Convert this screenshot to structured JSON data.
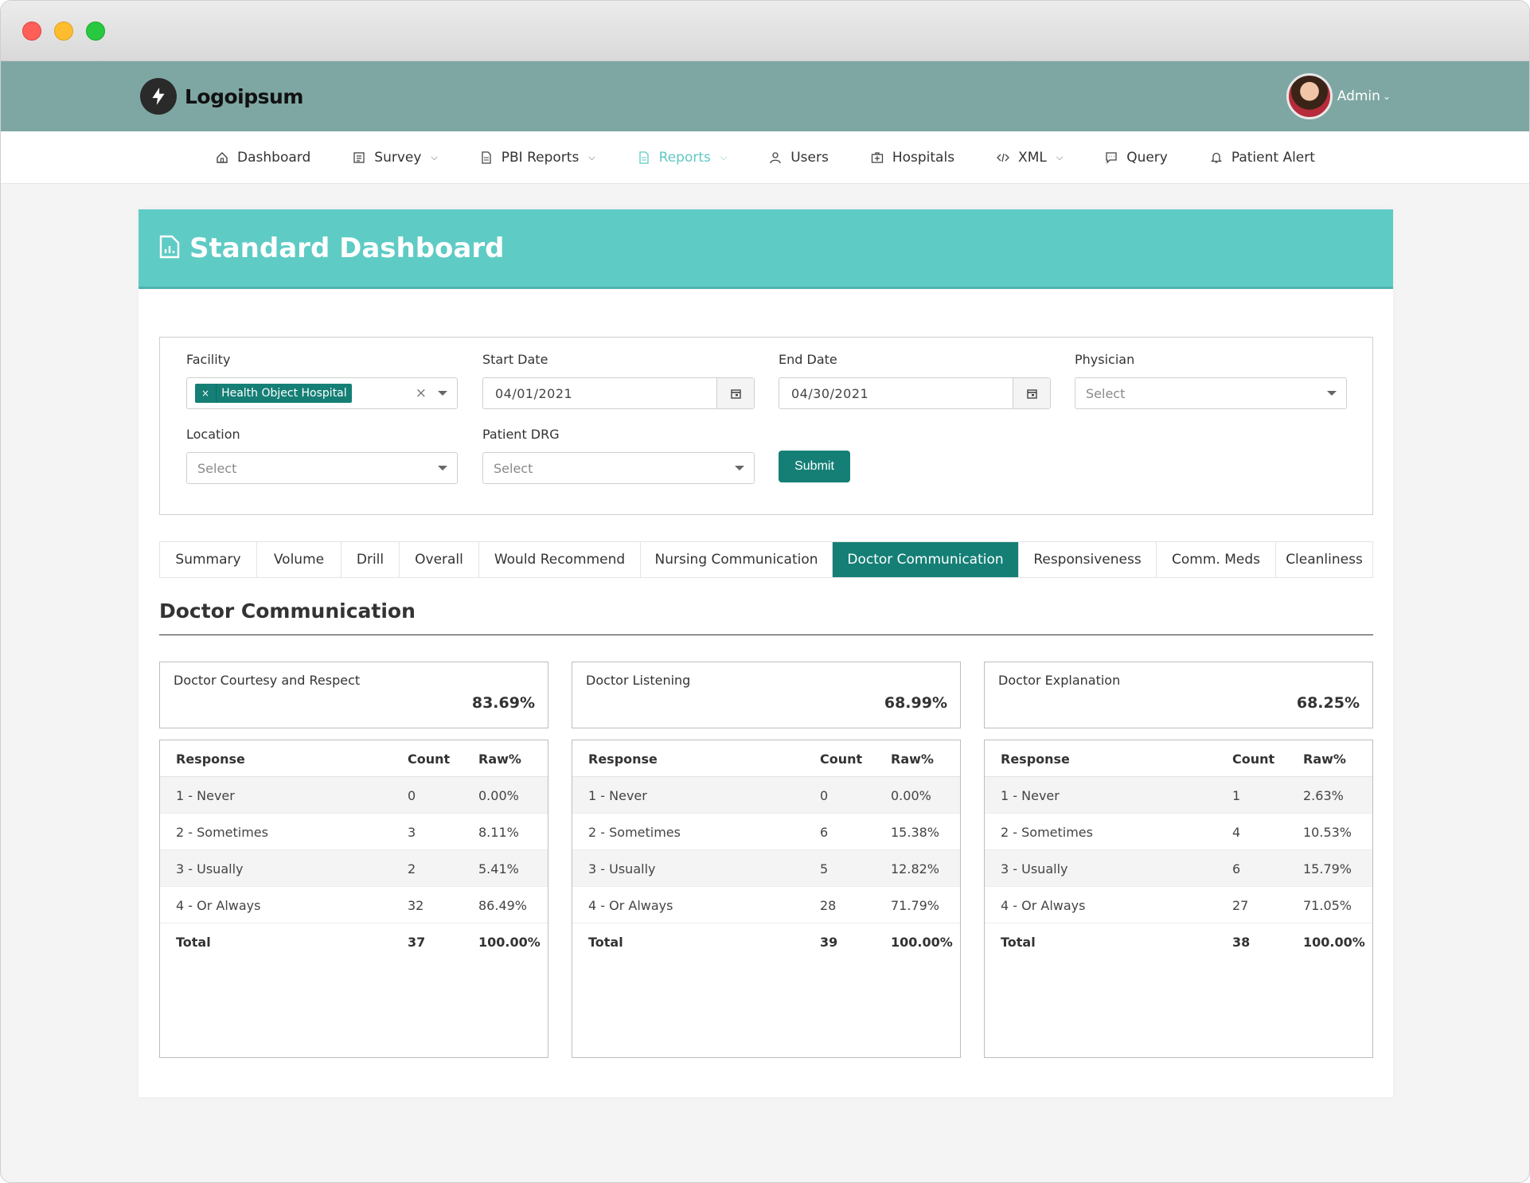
{
  "brand": {
    "name": "Logoipsum"
  },
  "user": {
    "name": "Admin"
  },
  "nav": [
    {
      "label": "Dashboard",
      "icon": "home-icon",
      "dropdown": false
    },
    {
      "label": "Survey",
      "icon": "list-icon",
      "dropdown": true
    },
    {
      "label": "PBI Reports",
      "icon": "document-icon",
      "dropdown": true
    },
    {
      "label": "Reports",
      "icon": "document-icon",
      "dropdown": true,
      "active": true
    },
    {
      "label": "Users",
      "icon": "user-icon",
      "dropdown": false
    },
    {
      "label": "Hospitals",
      "icon": "hospital-icon",
      "dropdown": false
    },
    {
      "label": "XML",
      "icon": "code-icon",
      "dropdown": true
    },
    {
      "label": "Query",
      "icon": "chat-icon",
      "dropdown": false
    },
    {
      "label": "Patient Alert",
      "icon": "bell-icon",
      "dropdown": false
    }
  ],
  "page": {
    "title": "Standard Dashboard"
  },
  "filters": {
    "facility": {
      "label": "Facility",
      "tag": "Health Object Hospital"
    },
    "start_date": {
      "label": "Start Date",
      "value": "04/01/2021"
    },
    "end_date": {
      "label": "End Date",
      "value": "04/30/2021"
    },
    "physician": {
      "label": "Physician",
      "placeholder": "Select"
    },
    "location": {
      "label": "Location",
      "placeholder": "Select"
    },
    "patient_drg": {
      "label": "Patient DRG",
      "placeholder": "Select"
    },
    "submit_label": "Submit"
  },
  "tabs": [
    {
      "label": "Summary"
    },
    {
      "label": "Volume"
    },
    {
      "label": "Drill"
    },
    {
      "label": "Overall"
    },
    {
      "label": "Would Recommend"
    },
    {
      "label": "Nursing Communication"
    },
    {
      "label": "Doctor Communication",
      "active": true
    },
    {
      "label": "Responsiveness"
    },
    {
      "label": "Comm. Meds"
    },
    {
      "label": "Cleanliness"
    }
  ],
  "section": {
    "title": "Doctor Communication"
  },
  "table_headers": {
    "response": "Response",
    "count": "Count",
    "raw": "Raw%"
  },
  "cards": [
    {
      "name": "Doctor Courtesy and Respect",
      "score": "83.69%",
      "rows": [
        {
          "response": "1 - Never",
          "count": "0",
          "raw": "0.00%"
        },
        {
          "response": "2 - Sometimes",
          "count": "3",
          "raw": "8.11%"
        },
        {
          "response": "3 - Usually",
          "count": "2",
          "raw": "5.41%"
        },
        {
          "response": "4 - Or Always",
          "count": "32",
          "raw": "86.49%"
        }
      ],
      "total": {
        "label": "Total",
        "count": "37",
        "raw": "100.00%"
      }
    },
    {
      "name": "Doctor Listening",
      "score": "68.99%",
      "rows": [
        {
          "response": "1 - Never",
          "count": "0",
          "raw": "0.00%"
        },
        {
          "response": "2 - Sometimes",
          "count": "6",
          "raw": "15.38%"
        },
        {
          "response": "3 - Usually",
          "count": "5",
          "raw": "12.82%"
        },
        {
          "response": "4 - Or Always",
          "count": "28",
          "raw": "71.79%"
        }
      ],
      "total": {
        "label": "Total",
        "count": "39",
        "raw": "100.00%"
      }
    },
    {
      "name": "Doctor Explanation",
      "score": "68.25%",
      "rows": [
        {
          "response": "1 - Never",
          "count": "1",
          "raw": "2.63%"
        },
        {
          "response": "2 - Sometimes",
          "count": "4",
          "raw": "10.53%"
        },
        {
          "response": "3 - Usually",
          "count": "6",
          "raw": "15.79%"
        },
        {
          "response": "4 - Or Always",
          "count": "27",
          "raw": "71.05%"
        }
      ],
      "total": {
        "label": "Total",
        "count": "38",
        "raw": "100.00%"
      }
    }
  ],
  "colors": {
    "header_bar": "#7ea7a3",
    "page_header": "#5fcbc5",
    "accent": "#157f76",
    "nav_active": "#5fc9c4"
  }
}
